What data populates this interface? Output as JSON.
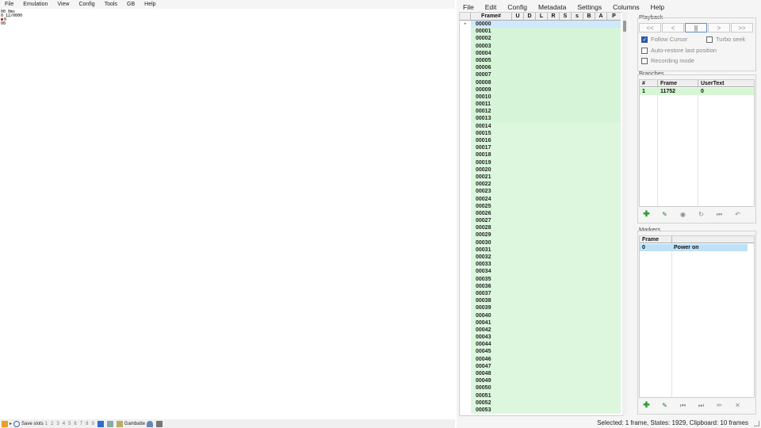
{
  "emulator": {
    "menu": [
      "File",
      "Emulation",
      "View",
      "Config",
      "Tools",
      "GB",
      "Help"
    ],
    "overlay_lines": [
      "00 0ms",
      "0 12/0000",
      "0",
      "00"
    ],
    "status": {
      "save_slots_label": "Save slots",
      "slots": [
        "1",
        "2",
        "3",
        "4",
        "5",
        "6",
        "7",
        "8",
        "9"
      ],
      "core_name": "Gambatte"
    }
  },
  "tastudio": {
    "menu": [
      "File",
      "Edit",
      "Config",
      "Metadata",
      "Settings",
      "Columns",
      "Help"
    ],
    "piano_roll": {
      "columns": [
        "Frame#",
        "U",
        "D",
        "L",
        "R",
        "S",
        "s",
        "B",
        "A",
        "P"
      ],
      "frames": [
        "00000",
        "00001",
        "00002",
        "00003",
        "00004",
        "00005",
        "00006",
        "00007",
        "00008",
        "00009",
        "00010",
        "00011",
        "00012",
        "00013",
        "00014",
        "00015",
        "00016",
        "00017",
        "00018",
        "00019",
        "00020",
        "00021",
        "00022",
        "00023",
        "00024",
        "00025",
        "00026",
        "00027",
        "00028",
        "00029",
        "00030",
        "00031",
        "00032",
        "00033",
        "00034",
        "00035",
        "00036",
        "00037",
        "00038",
        "00039",
        "00040",
        "00041",
        "00042",
        "00043",
        "00044",
        "00045",
        "00046",
        "00047",
        "00048",
        "00049",
        "00050",
        "00051",
        "00052",
        "00053"
      ],
      "current_frame_index": 0
    },
    "playback": {
      "title": "Playback",
      "buttons": [
        "<<",
        "<",
        "||",
        ">",
        ">>"
      ],
      "follow_cursor": {
        "label": "Follow Cursor",
        "checked": true
      },
      "turbo_seek": {
        "label": "Turbo seek",
        "checked": false
      },
      "auto_restore": {
        "label": "Auto-restore last position",
        "checked": false
      },
      "recording_mode": {
        "label": "Recording mode",
        "checked": false
      }
    },
    "branches": {
      "title": "Branches",
      "columns": [
        "#",
        "Frame",
        "UserText"
      ],
      "rows": [
        {
          "num": "1",
          "frame": "11752",
          "usertext": "0"
        }
      ]
    },
    "markers": {
      "title": "Markers",
      "columns": [
        "Frame",
        ""
      ],
      "rows": [
        {
          "frame": "0",
          "label": "Power on"
        }
      ]
    },
    "status": "Selected: 1 frame, States: 1929, Clipboard: 10 frames"
  },
  "colors": {
    "lag_green": "#d6f5d8",
    "current_row": "#cfe8fb",
    "branch_row": "#d7f6d5",
    "marker_row": "#bfe1f7"
  }
}
